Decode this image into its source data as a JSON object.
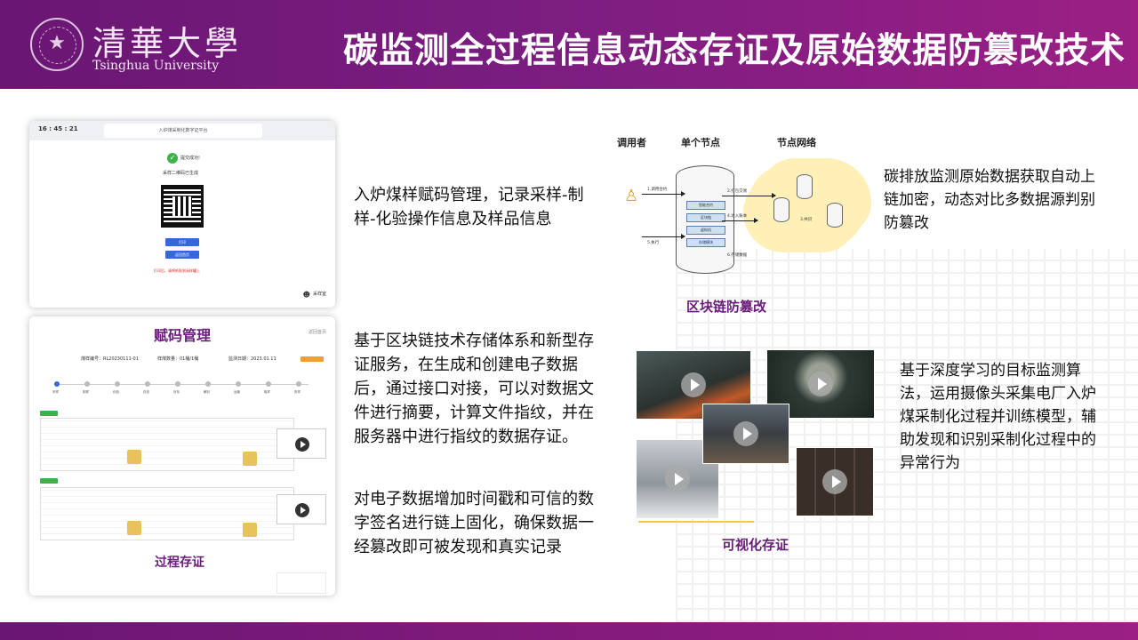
{
  "header": {
    "university_cn": "清華大學",
    "university_en": "Tsinghua University",
    "title": "碳监测全过程信息动态存证及原始数据防篡改技术"
  },
  "panel_qr": {
    "time": "16 : 45 : 21",
    "app_title": "入炉煤采制化数字证平台",
    "success_text": "提交成功!",
    "generated_text": "采样二维码已生成",
    "btn_print": "打印",
    "btn_back": "返回首页",
    "warning": "打印后，请将纸贴到采样罐上",
    "corner_label": "采样室"
  },
  "panel_process": {
    "title": "赋码管理",
    "corner": "返回首页",
    "meta": [
      "煤样编号：RL20230111-01",
      "样煤数量：01桶/1桶",
      "监测日期：2023.01.11"
    ],
    "steps": [
      "采样",
      "制样",
      "化验",
      "存查",
      "封存",
      "解封",
      "运输",
      "取样",
      "弃样"
    ],
    "badge1": "采样",
    "badge2": "制样",
    "caption": "过程存证"
  },
  "texts": {
    "t1": "入炉煤样赋码管理，记录采样-制样-化验操作信息及样品信息",
    "t2": "基于区块链技术存储体系和新型存证服务，在生成和创建电子数据后，通过接口对接，可以对数据文件进行摘要，计算文件指纹，并在服务器中进行指纹的数据存证。",
    "t3": "对电子数据增加时间戳和可信的数字签名进行链上固化，确保数据一经篡改即可被发现和真实记录",
    "t4": "碳排放监测原始数据获取自动上链加密，动态对比多数据源判别防篡改",
    "t5": "基于深度学习的目标监测算法，运用摄像头采集电厂入炉煤采制化过程并训练模型，辅助发现和识别采制化过程中的异常行为"
  },
  "diagram": {
    "col1": "调用者",
    "col2": "单个节点",
    "col3": "节点网络",
    "boxes": [
      "智能合约",
      "区块链",
      "虚拟机",
      "存储模块"
    ],
    "arrows": [
      "1.调用合约",
      "2.打包交易",
      "3.共识",
      "4.达入账本",
      "5.执行",
      "6.存储数据"
    ],
    "caption": "区块链防篡改"
  },
  "visual": {
    "caption": "可视化存证"
  }
}
